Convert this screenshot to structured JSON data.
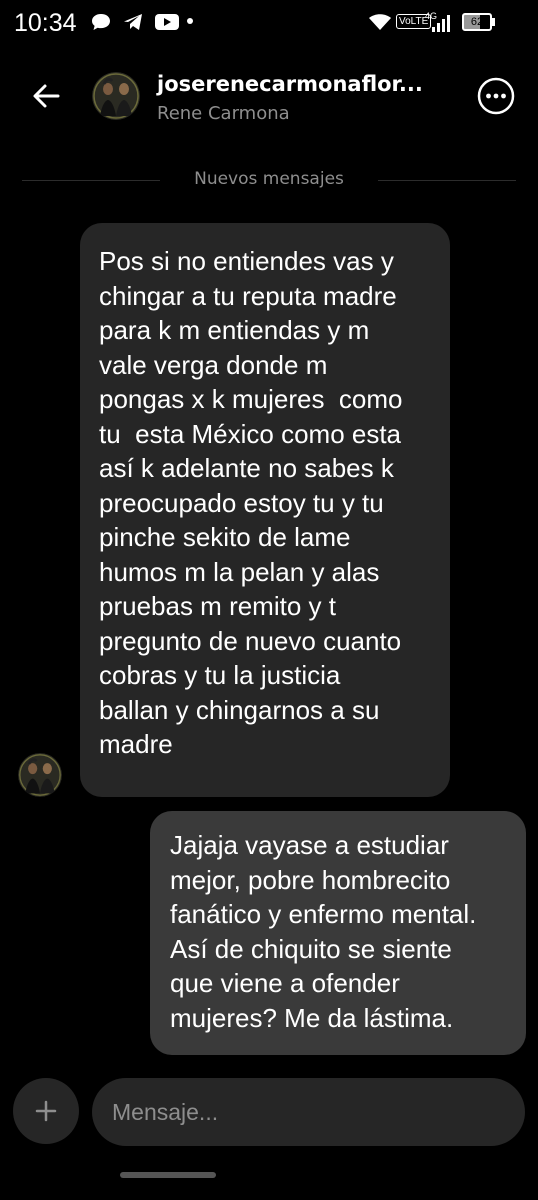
{
  "status_bar": {
    "time": "10:34",
    "network_label": "VoLTE",
    "network_gen": "4G",
    "battery": "62"
  },
  "header": {
    "username": "joserenecarmonaflor...",
    "display_name": "Rene Carmona"
  },
  "divider": {
    "label": "Nuevos mensajes"
  },
  "messages": {
    "incoming": {
      "lines": [
        "Pos si no entiendes vas y",
        "chingar a tu reputa madre",
        "para k m entiendas y m",
        "vale verga donde m",
        "pongas x k mujeres  como",
        "tu  esta México como esta",
        "así k adelante no sabes k",
        "preocupado estoy tu y tu",
        "pinche sekito de lame",
        "humos m la pelan y alas",
        "pruebas m remito y t",
        "pregunto de nuevo cuanto",
        "cobras y tu la justicia",
        "ballan y chingarnos a su",
        "madre"
      ]
    },
    "outgoing": {
      "lines": [
        "Jajaja vayase a estudiar",
        "mejor, pobre hombrecito",
        "fanático y enfermo mental.",
        "Así de chiquito se siente",
        "que viene a ofender",
        "mujeres? Me da lástima."
      ]
    }
  },
  "composer": {
    "placeholder": "Mensaje..."
  },
  "colors": {
    "background": "#000000",
    "incoming_bubble": "#262626",
    "outgoing_bubble": "#3a3a3a",
    "secondary_text": "#8e8e8e"
  },
  "icons": {
    "back": "arrow-left-icon",
    "more": "more-horizontal-icon",
    "add": "plus-icon"
  }
}
